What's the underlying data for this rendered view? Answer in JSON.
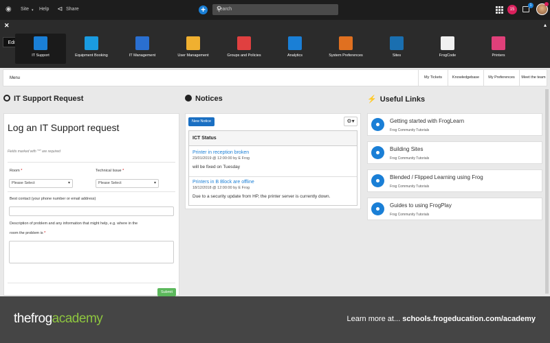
{
  "topbar": {
    "site_label": "Site",
    "help_label": "Help",
    "share_label": "Share",
    "search_placeholder": "Search",
    "notification_count": "15",
    "message_count": "1"
  },
  "appbar": {
    "edit_label": "Edit",
    "apps": [
      {
        "label": "IT Support",
        "icon": "monitor-icon",
        "color": "#1a7fd6",
        "active": true
      },
      {
        "label": "Equipment Booking",
        "icon": "calendar-icon",
        "color": "#1a9be0"
      },
      {
        "label": "IT Management",
        "icon": "chip-icon",
        "color": "#2a6fd0"
      },
      {
        "label": "User Management",
        "icon": "folder-user-icon",
        "color": "#f0b030"
      },
      {
        "label": "Groups and Policies",
        "icon": "groups-icon",
        "color": "#e04040"
      },
      {
        "label": "Analytics",
        "icon": "chart-icon",
        "color": "#1a7fd6"
      },
      {
        "label": "System Preferences",
        "icon": "tools-icon",
        "color": "#e07020"
      },
      {
        "label": "Sites",
        "icon": "globe-icon",
        "color": "#1a6fb0"
      },
      {
        "label": "FrogCode",
        "icon": "frogcode-icon",
        "color": "#f0f0f0"
      },
      {
        "label": "Printers",
        "icon": "printer-icon",
        "color": "#e0407a"
      }
    ]
  },
  "menubar": {
    "menu_label": "Menu",
    "tabs": [
      "My Tickets",
      "Knowledgebase",
      "My Preferences",
      "Meet the team"
    ]
  },
  "support": {
    "section_title": "IT Support Request",
    "form_title": "Log an IT Support request",
    "required_note": "Fields marked with \"*\" are required",
    "room_label": "Room",
    "room_select": "Please Select",
    "issue_label": "Technical Issue",
    "issue_select": "Please Select",
    "contact_label": "Best contact (your phone number or email address)",
    "desc_label_1": "Description of problem and any information that might help, e.g. where in the",
    "desc_label_2": "room the problem is",
    "star": "*",
    "submit_label": "Submit"
  },
  "notices": {
    "section_title": "Notices",
    "new_notice_label": "New Notice",
    "panel_title": "ICT Status",
    "items": [
      {
        "title": "Printer in reception broken",
        "meta": "23/01/2019 @ 12:00:00 by E Frog",
        "body": "will be fixed on Tuesday"
      },
      {
        "title": "Printers in B Block are offline",
        "meta": "18/12/2018 @ 12:00:00 by E Frog",
        "body": "Due to a security update from HP, the printer server is currently down."
      }
    ]
  },
  "links": {
    "section_title": "Useful Links",
    "items": [
      {
        "title": "Getting started with FrogLearn",
        "subtitle": "Frog Community Tutorials"
      },
      {
        "title": "Building Sites",
        "subtitle": "Frog Community Tutorials"
      },
      {
        "title": "Blended / Flipped Learning using Frog",
        "subtitle": "Frog Community Tutorials"
      },
      {
        "title": "Guides to using FrogPlay",
        "subtitle": "Frog Community Tutorials"
      }
    ]
  },
  "footer": {
    "brand_the": "the",
    "brand_frog": "frog",
    "brand_academy": "academy",
    "promo_text": "Learn more at...",
    "promo_url": "schools.frogeducation.com/academy"
  }
}
